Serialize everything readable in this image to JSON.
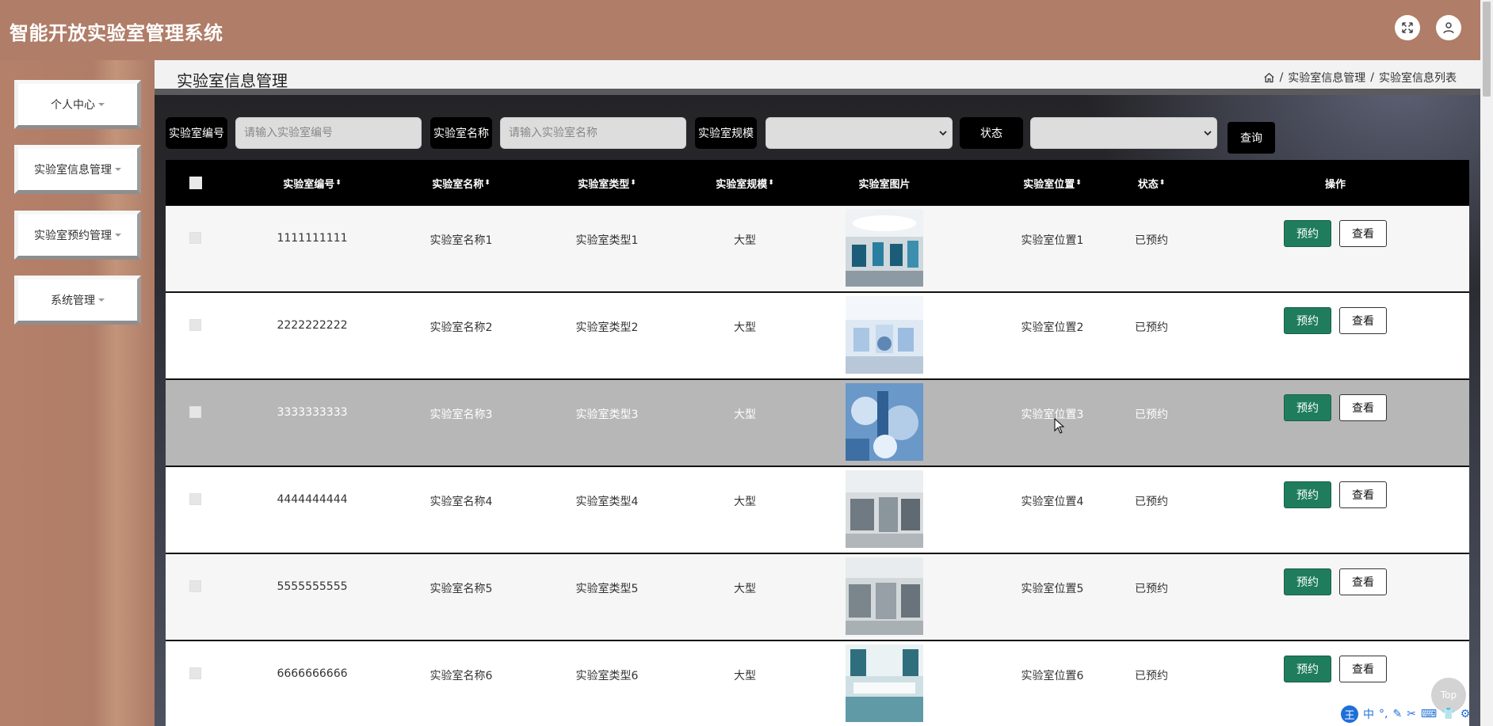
{
  "header": {
    "title": "智能开放实验室管理系统"
  },
  "sidebar": {
    "items": [
      {
        "label": "个人中心"
      },
      {
        "label": "实验室信息管理"
      },
      {
        "label": "实验室预约管理"
      },
      {
        "label": "系统管理"
      }
    ]
  },
  "page": {
    "title": "实验室信息管理",
    "breadcrumb": [
      "实验室信息管理",
      "实验室信息列表"
    ],
    "breadcrumb_sep": "/"
  },
  "search": {
    "lab_no_label": "实验室编号",
    "lab_no_placeholder": "请输入实验室编号",
    "lab_name_label": "实验室名称",
    "lab_name_placeholder": "请输入实验室名称",
    "lab_scale_label": "实验室规模",
    "status_label": "状态",
    "query_label": "查询"
  },
  "table": {
    "columns": [
      "实验室编号",
      "实验室名称",
      "实验室类型",
      "实验室规模",
      "实验室图片",
      "实验室位置",
      "状态",
      "操作"
    ],
    "rows": [
      {
        "no": "1111111111",
        "name": "实验室名称1",
        "type": "实验室类型1",
        "scale": "大型",
        "location": "实验室位置1",
        "status": "已预约"
      },
      {
        "no": "2222222222",
        "name": "实验室名称2",
        "type": "实验室类型2",
        "scale": "大型",
        "location": "实验室位置2",
        "status": "已预约"
      },
      {
        "no": "3333333333",
        "name": "实验室名称3",
        "type": "实验室类型3",
        "scale": "大型",
        "location": "实验室位置3",
        "status": "已预约"
      },
      {
        "no": "4444444444",
        "name": "实验室名称4",
        "type": "实验室类型4",
        "scale": "大型",
        "location": "实验室位置4",
        "status": "已预约"
      },
      {
        "no": "5555555555",
        "name": "实验室名称5",
        "type": "实验室类型5",
        "scale": "大型",
        "location": "实验室位置5",
        "status": "已预约"
      },
      {
        "no": "6666666666",
        "name": "实验室名称6",
        "type": "实验室类型6",
        "scale": "大型",
        "location": "实验室位置6",
        "status": "已预约"
      }
    ],
    "book_label": "预约",
    "view_label": "查看"
  },
  "top_button": "Top",
  "ime": {
    "logo": "王",
    "mode": "中"
  },
  "colors": {
    "header": "#b07d68",
    "book_button": "#1f7d5d",
    "table_header": "#000000"
  }
}
